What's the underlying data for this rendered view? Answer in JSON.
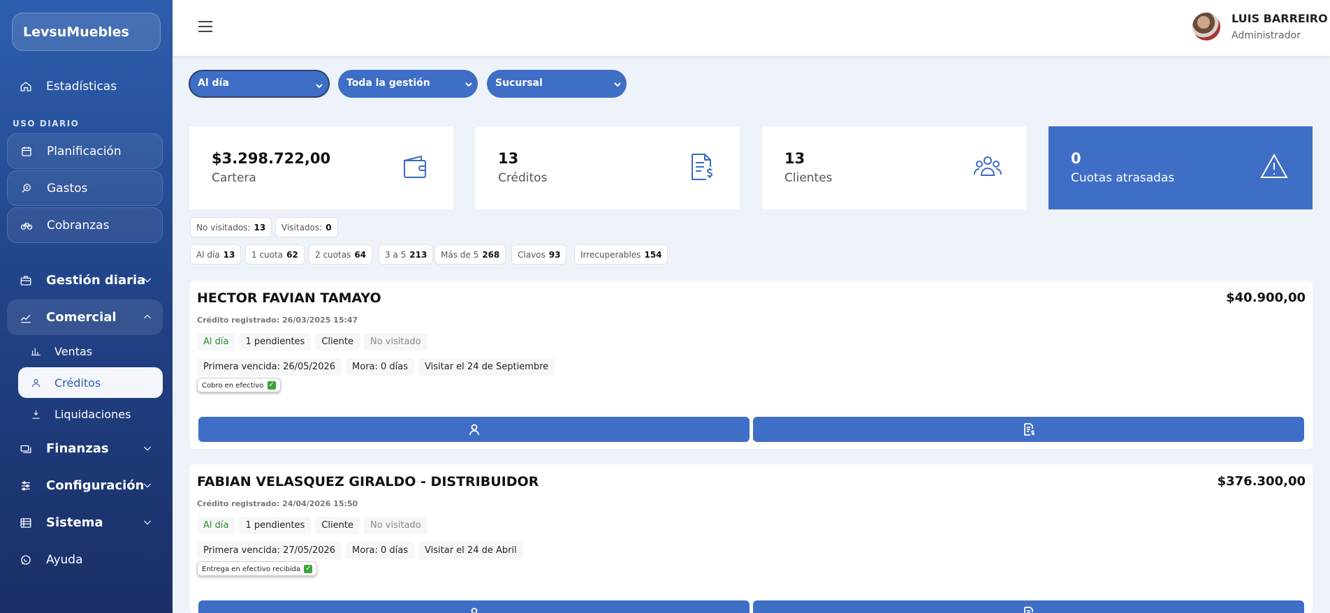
{
  "app": {
    "brand": "LevsuMuebles"
  },
  "sidebar": {
    "top_item": {
      "label": "Estadísticas",
      "icon": "home-icon"
    },
    "section_label": "USO DIARIO",
    "daily_items": [
      {
        "label": "Planificación",
        "icon": "calendar-icon"
      },
      {
        "label": "Gastos",
        "icon": "search-money-icon"
      },
      {
        "label": "Cobranzas",
        "icon": "bicycle-icon"
      }
    ],
    "groups": {
      "gestion": "Gestión diaria",
      "comercial": "Comercial",
      "finanzas": "Finanzas",
      "configuracion": "Configuración",
      "sistema": "Sistema"
    },
    "comercial_sub": {
      "ventas": "Ventas",
      "creditos": "Créditos",
      "liquidaciones": "Liquidaciones"
    },
    "help": "Ayuda"
  },
  "header": {
    "user_name": "LUIS BARREIRO",
    "user_role": "Administrador"
  },
  "filters": [
    "Al día",
    "Toda la gestión",
    "Sucursal"
  ],
  "stats": [
    {
      "value": "$3.298.722,00",
      "label": "Cartera",
      "icon": "wallet-icon"
    },
    {
      "value": "13",
      "label": "Créditos",
      "icon": "invoice-dollar-icon"
    },
    {
      "value": "13",
      "label": "Clientes",
      "icon": "users-group-icon"
    },
    {
      "value": "0",
      "label": "Cuotas atrasadas",
      "icon": "warning-icon"
    }
  ],
  "visit_chips": [
    {
      "label": "No visitados:",
      "count": "13"
    },
    {
      "label": "Visitados:",
      "count": "0"
    }
  ],
  "status_chips": [
    {
      "label": "Al día",
      "count": "13"
    },
    {
      "label": "1 cuota",
      "count": "62"
    },
    {
      "label": "2 cuotas",
      "count": "64"
    },
    {
      "label": "3 a 5",
      "count": "213"
    },
    {
      "label": "Más de 5",
      "count": "268"
    },
    {
      "label": "Clavos",
      "count": "93"
    },
    {
      "label": "Irrecuperables",
      "count": "154"
    }
  ],
  "credits": [
    {
      "name": "HECTOR FAVIAN TAMAYO",
      "amount": "$40.900,00",
      "registered": "Crédito registrado: 26/03/2025 15:47",
      "status": "Al día",
      "pending": "1 pendientes",
      "type": "Cliente",
      "visit": "No visitado",
      "first_due": "Primera vencida: 26/05/2026",
      "mora": "Mora: 0 días",
      "visit_date": "Visitar el 24 de Septiembre",
      "badge": "Cobro en efectivo"
    },
    {
      "name": "FABIAN VELASQUEZ GIRALDO - DISTRIBUIDOR",
      "amount": "$376.300,00",
      "registered": "Crédito registrado: 24/04/2026 15:50",
      "status": "Al día",
      "pending": "1 pendientes",
      "type": "Cliente",
      "visit": "No visitado",
      "first_due": "Primera vencida: 27/05/2026",
      "mora": "Mora: 0 días",
      "visit_date": "Visitar el 24 de Abril",
      "badge": "Entrega en efectivo recibida"
    }
  ]
}
